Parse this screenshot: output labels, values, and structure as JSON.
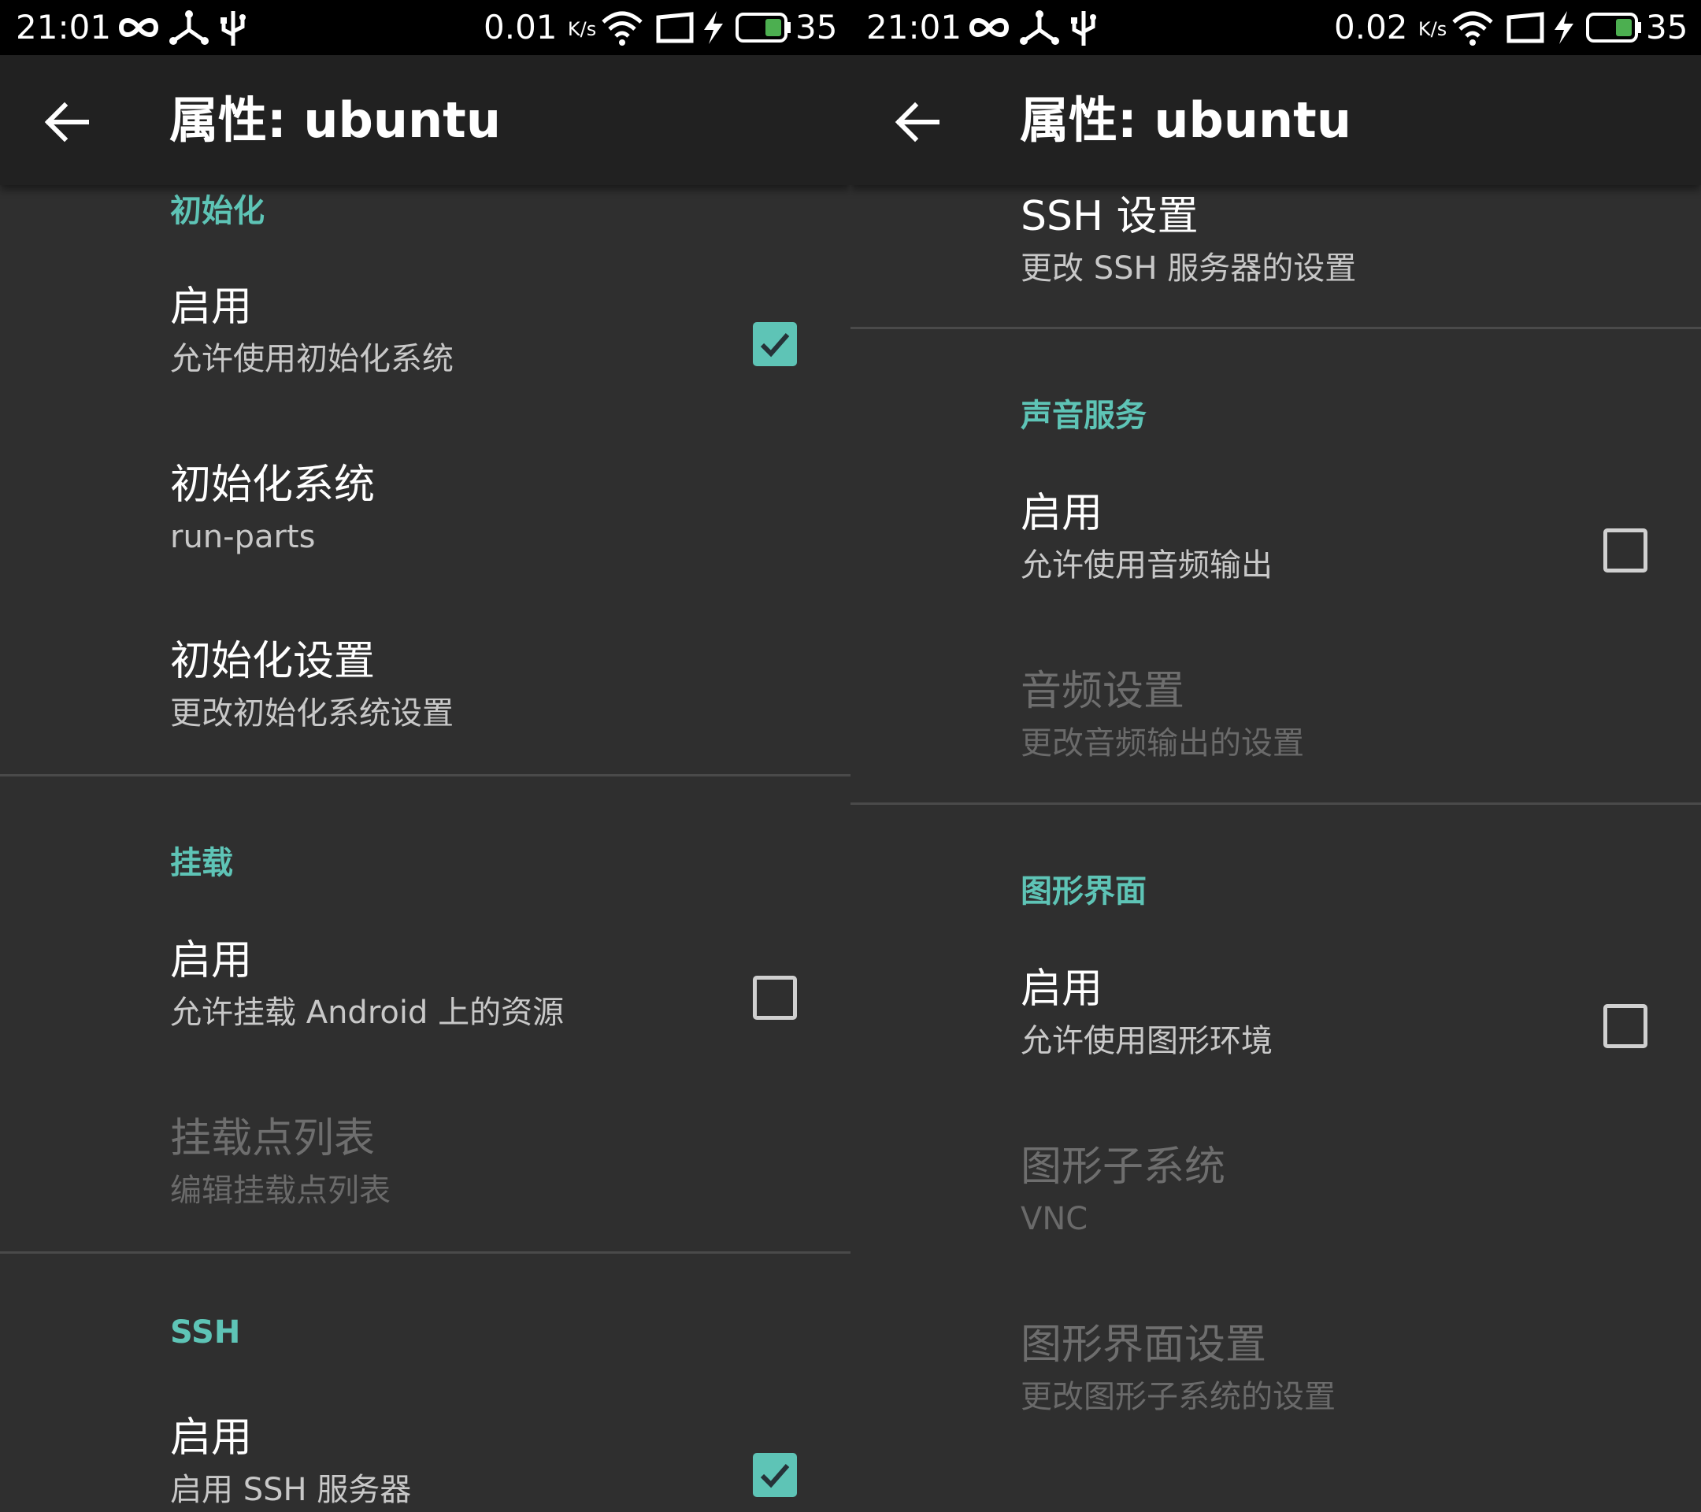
{
  "status_bar_left": {
    "time": "21:01",
    "speed": "0.01",
    "speed_unit": "K/s",
    "battery": "35",
    "icons": [
      "infinity-icon",
      "usb-share-icon",
      "usb-icon",
      "wifi-icon",
      "screen-icon",
      "charging-icon",
      "battery-icon"
    ]
  },
  "status_bar_right": {
    "time": "21:01",
    "speed": "0.02",
    "speed_unit": "K/s",
    "battery": "35"
  },
  "toolbar": {
    "title": "属性: ubuntu",
    "back_icon": "arrow-back-icon"
  },
  "left": {
    "init": {
      "category": "初始化",
      "enable_title": "启用",
      "enable_summary": "允许使用初始化系统",
      "enable_checked": true,
      "system_title": "初始化系统",
      "system_summary": "run-parts",
      "settings_title": "初始化设置",
      "settings_summary": "更改初始化系统设置"
    },
    "mount": {
      "category": "挂载",
      "enable_title": "启用",
      "enable_summary": "允许挂载 Android 上的资源",
      "enable_checked": false,
      "points_title": "挂载点列表",
      "points_summary": "编辑挂载点列表"
    },
    "ssh": {
      "category": "SSH",
      "enable_title": "启用",
      "enable_summary": "启用 SSH 服务器",
      "enable_checked": true
    }
  },
  "right": {
    "ssh_settings_title": "SSH 设置",
    "ssh_settings_summary": "更改 SSH 服务器的设置",
    "sound": {
      "category": "声音服务",
      "enable_title": "启用",
      "enable_summary": "允许使用音频输出",
      "enable_checked": false,
      "settings_title": "音频设置",
      "settings_summary": "更改音频输出的设置"
    },
    "gui": {
      "category": "图形界面",
      "enable_title": "启用",
      "enable_summary": "允许使用图形环境",
      "enable_checked": false,
      "subsystem_title": "图形子系统",
      "subsystem_summary": "VNC",
      "settings_title": "图形界面设置",
      "settings_summary": "更改图形子系统的设置"
    }
  },
  "colors": {
    "accent": "#5ec4b6",
    "background": "#2f2f2f",
    "toolbar": "#212121",
    "status_bar": "#000000"
  }
}
